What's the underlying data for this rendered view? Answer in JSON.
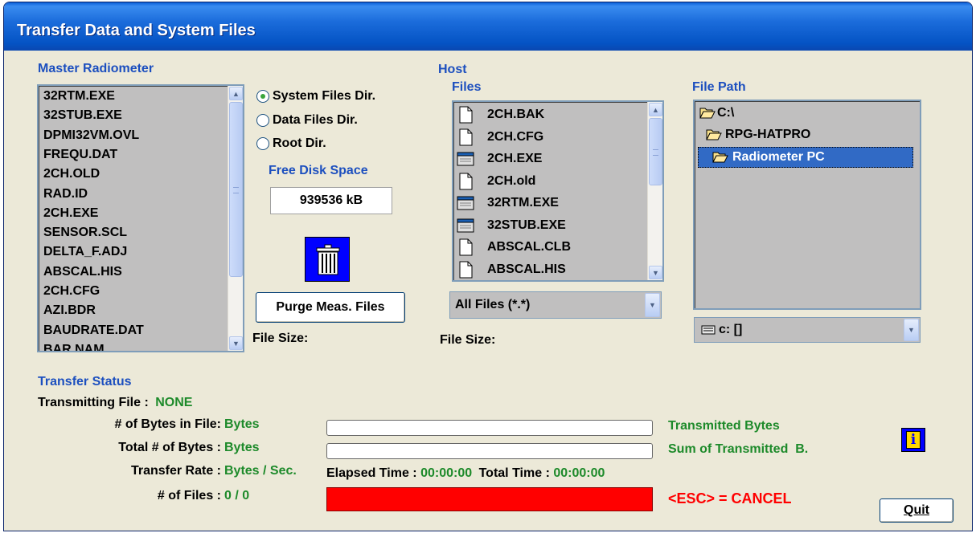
{
  "window": {
    "title": "Transfer Data and System Files"
  },
  "master": {
    "heading": "Master Radiometer",
    "files": [
      "32RTM.EXE",
      "32STUB.EXE",
      "DPMI32VM.OVL",
      "FREQU.DAT",
      "2CH.OLD",
      "RAD.ID",
      "2CH.EXE",
      "SENSOR.SCL",
      "DELTA_F.ADJ",
      "ABSCAL.HIS",
      "2CH.CFG",
      "AZI.BDR",
      "BAUDRATE.DAT",
      "BAR.NAM"
    ],
    "file_size_label": "File Size:"
  },
  "dir_options": {
    "selected": "System Files Dir.",
    "items": [
      "System Files Dir.",
      "Data Files Dir.",
      "Root Dir."
    ]
  },
  "disk": {
    "label": "Free Disk Space",
    "value": "939536 kB",
    "trash_icon": "trash-icon"
  },
  "purge_button": "Purge Meas. Files",
  "host": {
    "heading": "Host",
    "files_label": "Files",
    "files": [
      {
        "name": "2CH.BAK",
        "icon": "document-icon"
      },
      {
        "name": "2CH.CFG",
        "icon": "document-icon"
      },
      {
        "name": "2CH.EXE",
        "icon": "executable-icon"
      },
      {
        "name": "2CH.old",
        "icon": "document-icon"
      },
      {
        "name": "32RTM.EXE",
        "icon": "executable-icon"
      },
      {
        "name": "32STUB.EXE",
        "icon": "executable-icon"
      },
      {
        "name": "ABSCAL.CLB",
        "icon": "document-icon"
      },
      {
        "name": "ABSCAL.HIS",
        "icon": "document-icon"
      }
    ],
    "filter": "All Files (*.*)",
    "file_size_label": "File Size:"
  },
  "file_path": {
    "label": "File Path",
    "items": [
      {
        "name": "C:\\",
        "icon": "open-folder-icon"
      },
      {
        "name": "RPG-HATPRO",
        "icon": "open-folder-icon"
      },
      {
        "name": "Radiometer PC",
        "icon": "open-folder-icon",
        "selected": true
      }
    ],
    "drive": "c: []"
  },
  "status": {
    "heading": "Transfer Status",
    "transmitting_label": "Transmitting File :",
    "transmitting_value": "NONE",
    "bytes_in_file_label": "# of Bytes in File:",
    "bytes_in_file_value": "Bytes",
    "total_bytes_label": "Total # of Bytes :",
    "total_bytes_value": "Bytes",
    "rate_label": "Transfer Rate :",
    "rate_value": "Bytes / Sec.",
    "num_files_label": "# of Files :",
    "num_files_value": "0 / 0",
    "transmitted_label": "Transmitted Bytes",
    "sum_label": "Sum of Transmitted  B.",
    "file_progress": 0,
    "total_progress": 0,
    "elapsed_label": "Elapsed Time :",
    "elapsed_value": "00:00:00",
    "total_time_label": "Total Time :",
    "total_time_value": "00:00:00",
    "cancel_text": "<ESC> = CANCEL"
  },
  "quit_button": "Quit",
  "colors": {
    "accent": "#1c4fbf",
    "green": "#1d8a2a",
    "cancel": "#ff0000",
    "title_bar": "#0453c4"
  }
}
